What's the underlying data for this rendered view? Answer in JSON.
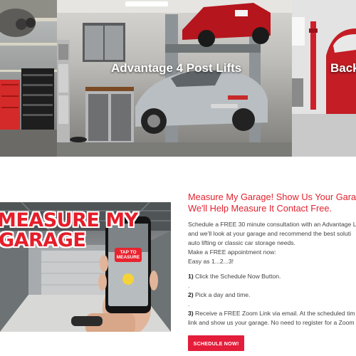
{
  "carousel": {
    "slides": [
      {
        "title": ""
      },
      {
        "title": "Advantage 4 Post Lifts"
      },
      {
        "title": "Back"
      }
    ]
  },
  "video": {
    "thumb_line1": "MEASURE MY",
    "thumb_line2": "GARAGE",
    "phone_label_line1": "TAP TO",
    "phone_label_line2": "MEASURE"
  },
  "content": {
    "heading_line1": "Measure My Garage! Show Us Your Garage",
    "heading_line2": "We'll Help Measure It Contact Free.",
    "paragraph_lines": [
      "Schedule a FREE 30 minute consultation with an Advantage L",
      "and we'll look at your garage and recommend the best soluti",
      "auto lifting or classic car storage needs.",
      "Make a FREE appointment now:",
      "Easy as 1...2...3!"
    ],
    "step1_num": "1)",
    "step1_text": " Click the Schedule Now Button.",
    "sep1": ".",
    "step2_num": "2)",
    "step2_text": " Pick a day and time.",
    "sep2": ".",
    "step3_num": "3)",
    "step3_line1": " Receive a FREE Zoom Link via email. At the scheduled tim",
    "step3_line2": "link and show us your garage. No need to register for a Zoom",
    "button_label": "SCHEDULE NOW!"
  },
  "colors": {
    "accent": "#e3222f",
    "button_bg": "#e31d3a",
    "body_text": "#444444"
  }
}
